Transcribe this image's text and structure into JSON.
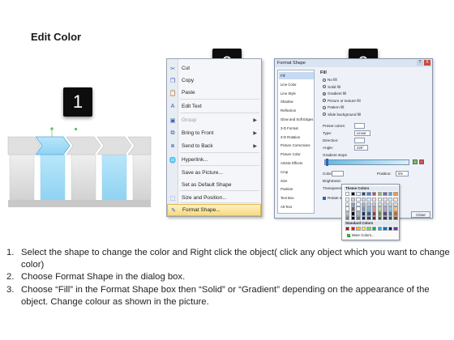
{
  "title": "Edit Color",
  "badges": [
    "1",
    "2",
    "3"
  ],
  "colors": {
    "accent_blue": "#8fd3f2",
    "block_gray": "#d9d9d9",
    "menu_highlight": "#f8d97c",
    "badge_bg": "#0d0d0d"
  },
  "context_menu": {
    "items": [
      {
        "label": "Cut",
        "icon": "scissors-icon",
        "underline": 0
      },
      {
        "label": "Copy",
        "icon": "copy-icon"
      },
      {
        "label": "Paste",
        "icon": "paste-icon"
      },
      {
        "label": "Edit Text",
        "icon": "edit-text-icon"
      },
      {
        "label": "Group",
        "icon": "group-icon",
        "submenu": true,
        "disabled": true
      },
      {
        "label": "Bring to Front",
        "icon": "bring-front-icon",
        "submenu": true
      },
      {
        "label": "Send to Back",
        "icon": "send-back-icon",
        "submenu": true
      },
      {
        "label": "Hyperlink...",
        "icon": "hyperlink-icon"
      },
      {
        "label": "Save as Picture...",
        "icon": ""
      },
      {
        "label": "Set as Default Shape",
        "icon": ""
      },
      {
        "label": "Size and Position...",
        "icon": "size-position-icon"
      },
      {
        "label": "Format Shape...",
        "icon": "format-shape-icon",
        "highlighted": true
      }
    ]
  },
  "format_shape": {
    "title": "Format Shape",
    "help": "?",
    "close_x": "X",
    "categories": [
      "Fill",
      "Line Color",
      "Line Style",
      "Shadow",
      "Reflection",
      "Glow and Soft Edges",
      "3-D Format",
      "3-D Rotation",
      "Picture Corrections",
      "Picture Color",
      "Artistic Effects",
      "Crop",
      "Size",
      "Position",
      "Text Box",
      "Alt Text"
    ],
    "selected_category": "Fill",
    "section_heading": "Fill",
    "fill_options": [
      "No fill",
      "Solid fill",
      "Gradient fill",
      "Picture or texture fill",
      "Pattern fill",
      "Slide background fill"
    ],
    "selected_fill": "Gradient fill",
    "preset_colors_label": "Preset colors:",
    "type_label": "Type:",
    "type_value": "Linear",
    "direction_label": "Direction:",
    "angle_label": "Angle:",
    "angle_value": "225°",
    "gradient_stops_label": "Gradient stops",
    "color_label": "Color",
    "position_label": "Position:",
    "position_value": "0%",
    "brightness_label": "Brightness:",
    "transparency_label": "Transparency:",
    "rotate_label": "Rotate w",
    "close_button": "Close"
  },
  "color_palette": {
    "theme_heading": "Theme Colors",
    "standard_heading": "Standard Colors",
    "more_colors": "More Colors...",
    "theme_top": [
      "#ffffff",
      "#000000",
      "#eeece1",
      "#1f497d",
      "#4f81bd",
      "#c0504d",
      "#9bbb59",
      "#8064a2",
      "#4bacc6",
      "#f79646"
    ],
    "standard": [
      "#c00000",
      "#ff0000",
      "#ffc000",
      "#ffff00",
      "#92d050",
      "#00b050",
      "#00b0f0",
      "#0070c0",
      "#002060",
      "#7030a0"
    ]
  },
  "instructions": [
    {
      "num": "1.",
      "text": "Select the shape to change the color and Right click the object( click any object which you want to change color)"
    },
    {
      "num": "2.",
      "text": "Choose Format Shape in the dialog box."
    },
    {
      "num": "3.",
      "text": "Choose “Fill” in the Format Shape box then “Solid” or “Gradient” depending on the appearance of the object. Change colour as shown in the picture."
    }
  ]
}
